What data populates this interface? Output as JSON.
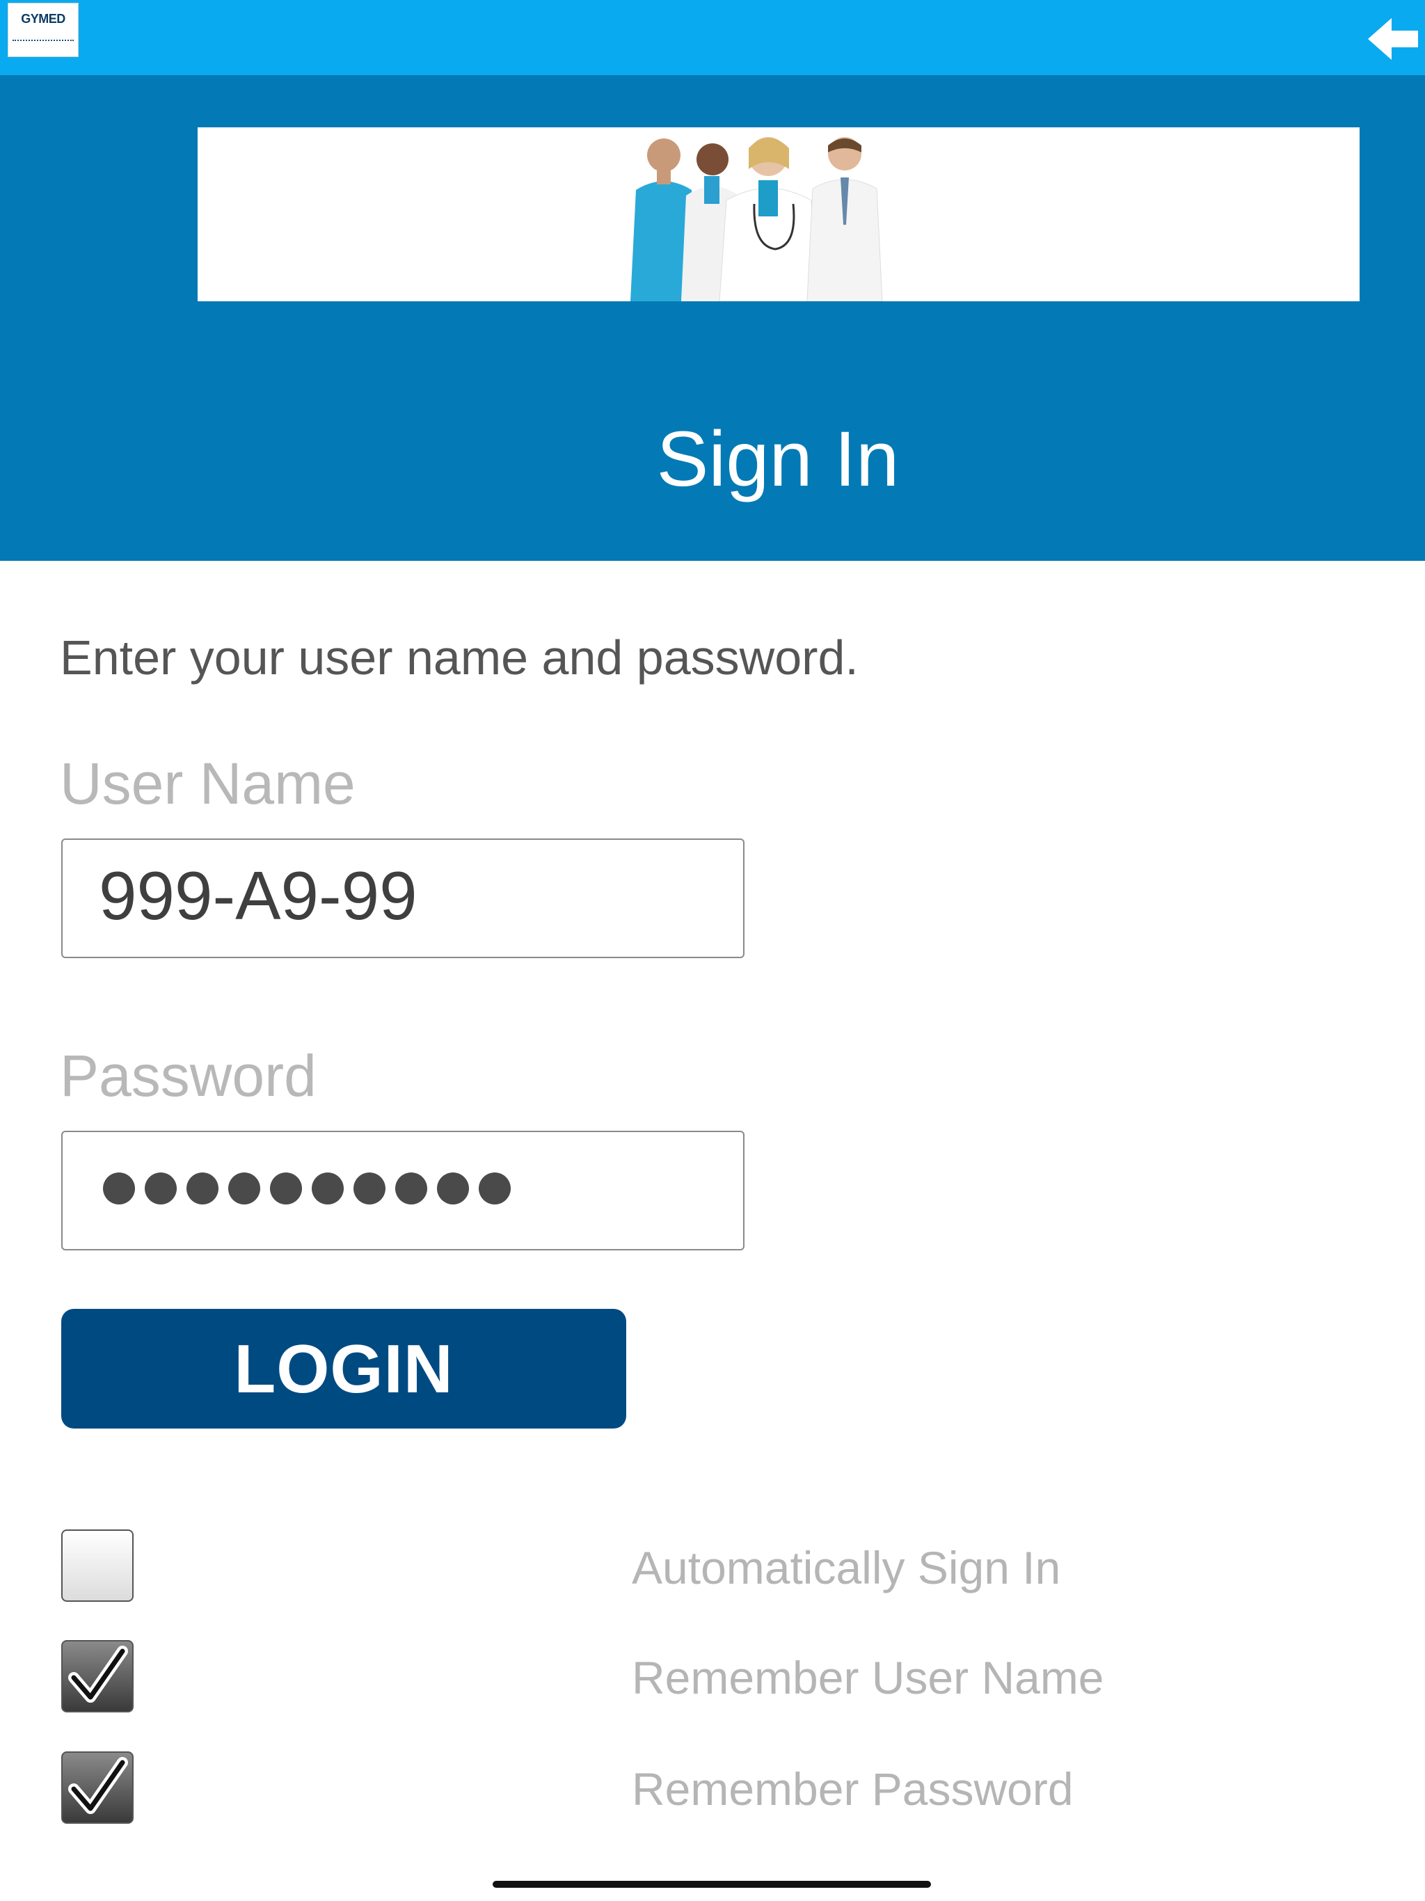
{
  "app": {
    "logo_text": "GYMED",
    "back_icon": "arrow-left-icon"
  },
  "header": {
    "title": "Sign In",
    "banner_image": "doctors-group-photo"
  },
  "form": {
    "instructions": "Enter your user name and password.",
    "username": {
      "label": "User Name",
      "value": "999-A9-99"
    },
    "password": {
      "label": "Password",
      "masked_length": 10
    },
    "login_label": "LOGIN"
  },
  "options": [
    {
      "label": "Automatically Sign In",
      "checked": false
    },
    {
      "label": "Remember User Name",
      "checked": true
    },
    {
      "label": "Remember Password",
      "checked": true
    }
  ],
  "colors": {
    "topbar": "#0aaaf0",
    "header": "#037ab5",
    "login_button": "#004a82"
  }
}
